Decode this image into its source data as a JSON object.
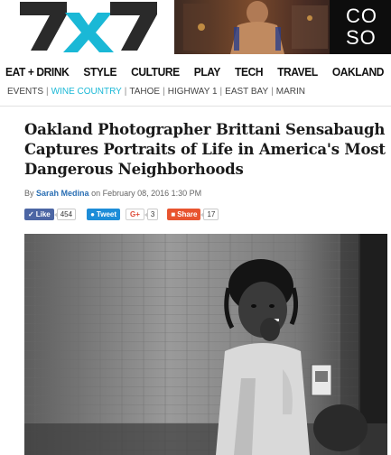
{
  "site": {
    "logo_text": "7x7"
  },
  "ad": {
    "text_line1": "CO",
    "text_line2": "SO"
  },
  "nav": {
    "main": [
      "EAT + DRINK",
      "STYLE",
      "CULTURE",
      "PLAY",
      "TECH",
      "TRAVEL",
      "OAKLAND"
    ],
    "sub": [
      "EVENTS",
      "WINE COUNTRY",
      "TAHOE",
      "HIGHWAY 1",
      "EAST BAY",
      "MARIN"
    ],
    "sub_active_index": 1,
    "separator": "|"
  },
  "article": {
    "headline": "Oakland Photographer Brittani Sensabaugh Captures Portraits of Life in America's Most Dangerous Neighborhoods",
    "byline_prefix": "By",
    "author": "Sarah Medina",
    "byline_suffix": "on February 08, 2016 1:30 PM"
  },
  "share": {
    "like_label": "Like",
    "like_count": "454",
    "tweet_label": "Tweet",
    "gplus_label": "G+",
    "gplus_count": "3",
    "share_label": "Share",
    "share_count": "17"
  },
  "colors": {
    "logo_black": "#222222",
    "logo_teal": "#1ab8d6",
    "active_sub": "#1ab8d6",
    "facebook": "#4c66a4",
    "twitter": "#1d8dd8",
    "share": "#e8542f"
  }
}
